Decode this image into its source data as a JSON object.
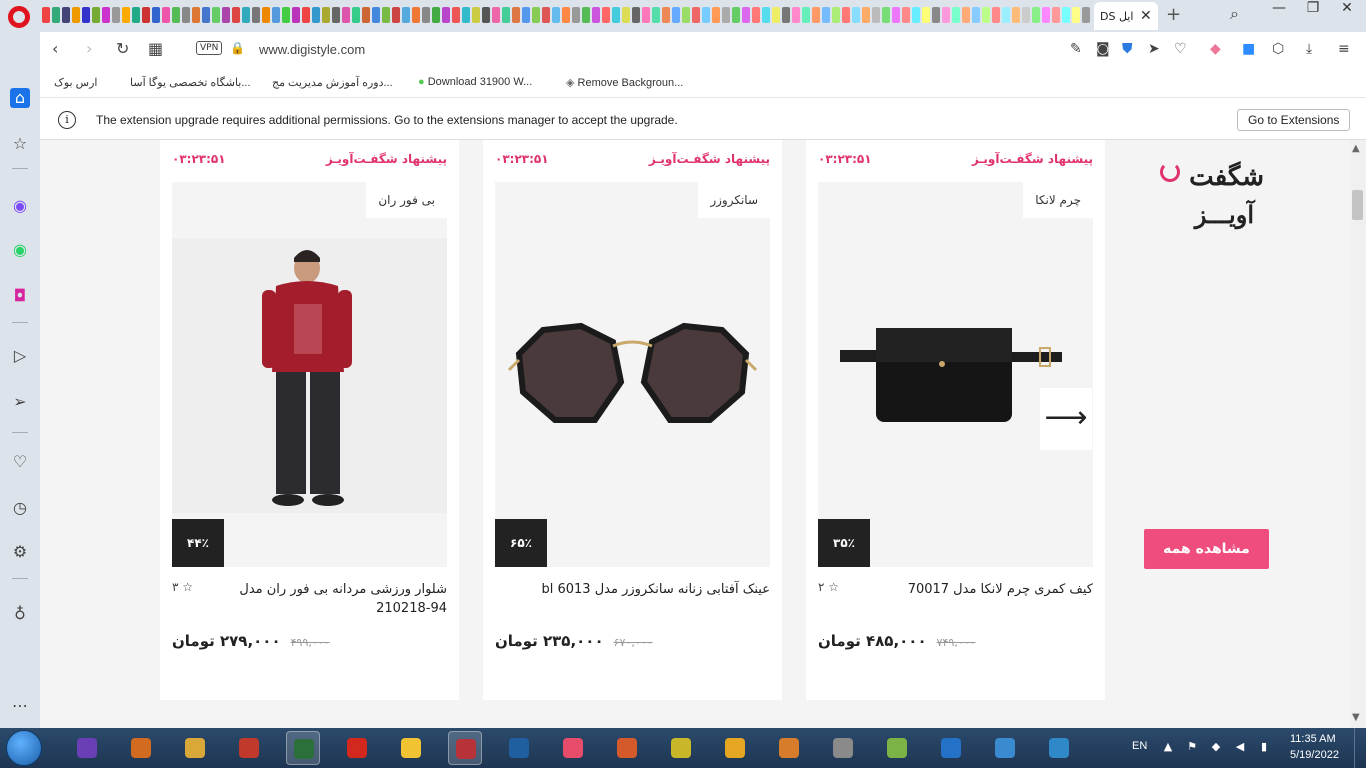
{
  "browser": {
    "active_tab_title": "DS ایل",
    "url": "www.digistyle.com",
    "vpn_label": "VPN",
    "win_minimize": "—",
    "win_restore": "❐",
    "win_close": "✕",
    "new_tab": "+",
    "tab_close": "✕"
  },
  "tab_favicon_colors": [
    "#e44",
    "#3a7",
    "#447",
    "#e90",
    "#33c",
    "#7a3",
    "#c3c",
    "#999",
    "#fa0",
    "#2a8",
    "#c33",
    "#36c",
    "#e5a",
    "#5b5",
    "#888",
    "#d73",
    "#47c",
    "#6c6",
    "#a4a",
    "#d44",
    "#3ab",
    "#777",
    "#e80",
    "#59d",
    "#4c4",
    "#b3b",
    "#e44",
    "#39c",
    "#aa3",
    "#666",
    "#d5a",
    "#3c8",
    "#c63",
    "#48d",
    "#7b4",
    "#c44",
    "#5ad",
    "#e73",
    "#888",
    "#4a4",
    "#b4c",
    "#e55",
    "#3bc",
    "#cc4",
    "#555",
    "#e6a",
    "#4c9",
    "#d74",
    "#59e",
    "#8c5",
    "#d55",
    "#6be",
    "#f84",
    "#999",
    "#5b5",
    "#c5d",
    "#f66",
    "#4cd",
    "#dd5",
    "#666",
    "#f7b",
    "#5da",
    "#e85",
    "#6af",
    "#9d6",
    "#e66",
    "#7cf",
    "#f95",
    "#aaa",
    "#6c6",
    "#d6e",
    "#f77",
    "#5de",
    "#ee6",
    "#777",
    "#f8c",
    "#6eb",
    "#f96",
    "#7bf",
    "#ae7",
    "#f77",
    "#8df",
    "#fa6",
    "#bbb",
    "#7d7",
    "#e7f",
    "#f88",
    "#6ef",
    "#ff7",
    "#888",
    "#f9d",
    "#7fc",
    "#fa7",
    "#8cf",
    "#bf8",
    "#f88",
    "#9ef",
    "#fb7",
    "#ccc",
    "#8e8",
    "#f8f",
    "#f99",
    "#7ff",
    "#ff8",
    "#999",
    "#fae",
    "#8fd",
    "#fb8",
    "#9df",
    "#cf9",
    "#f99",
    "#aff",
    "#fc8",
    "#ddd",
    "#9f9",
    "#f9f",
    "#faa",
    "#8ff",
    "#ff9",
    "#aaa",
    "#fbf",
    "#9fe",
    "#fc9"
  ],
  "bookmarks": [
    {
      "label": "ارس بوک"
    },
    {
      "label": "باشگاه تخصصی یوگا آسا..."
    },
    {
      "label": "دوره آموزش مدیریت مج..."
    },
    {
      "label": "Download 31900 W..."
    },
    {
      "label": "Remove Backgroun..."
    }
  ],
  "infobar": {
    "message": "The extension upgrade requires additional permissions. Go to the extensions manager to accept the upgrade.",
    "button_label": "Go to Extensions"
  },
  "section": {
    "logo_top": "شگفت",
    "logo_bottom": "آویـــز",
    "view_all_label": "مشاهده همه",
    "next_arrow": "⟶"
  },
  "products": [
    {
      "timer": "۰۳:۲۳:۵۱",
      "badge": "پیشنهاد شگفـت‌آویـز",
      "brand": "بی فور ران",
      "discount": "۴۴٪",
      "name": "شلوار ورزشی مردانه بی فور ران مدل 94-210218",
      "rating": "۳",
      "price": "۲۷۹,۰۰۰ تومان",
      "old_price": "۴۹۹,۰۰۰"
    },
    {
      "timer": "۰۳:۲۳:۵۱",
      "badge": "پیشنهاد شگفـت‌آویـز",
      "brand": "سانکروزر",
      "discount": "۶۵٪",
      "name": "عینک آفتابی زنانه سانکروزر مدل bl 6013",
      "rating": "",
      "price": "۲۳۵,۰۰۰ تومان",
      "old_price": "۶۷۰,۰۰۰"
    },
    {
      "timer": "۰۳:۲۳:۵۱",
      "badge": "پیشنهاد شگفـت‌آویـز",
      "brand": "چرم لانکا",
      "discount": "۳۵٪",
      "name": "کیف کمری چرم لانکا مدل 70017",
      "rating": "۲",
      "price": "۴۸۵,۰۰۰ تومان",
      "old_price": "۷۴۹,۰۰۰"
    }
  ],
  "taskbar": {
    "lang": "EN",
    "time": "11:35 AM",
    "date": "5/19/2022",
    "app_colors": [
      "#6a3fb5",
      "#d26a1f",
      "#d9a838",
      "#c0392b",
      "#2b6f3a",
      "#d3281e",
      "#f1c232",
      "#b8323a",
      "#1f5fa0",
      "#e84c6b",
      "#d55a2b",
      "#c9b72a",
      "#e5a623",
      "#d77c2a",
      "#8a8a8a",
      "#7bb347",
      "#2472c8",
      "#3a8ad0",
      "#2f88c8"
    ]
  },
  "accent_colors": {
    "pink": "#e0336b",
    "view_all_bg": "#ee4d7d",
    "badge_bg": "#222222"
  }
}
